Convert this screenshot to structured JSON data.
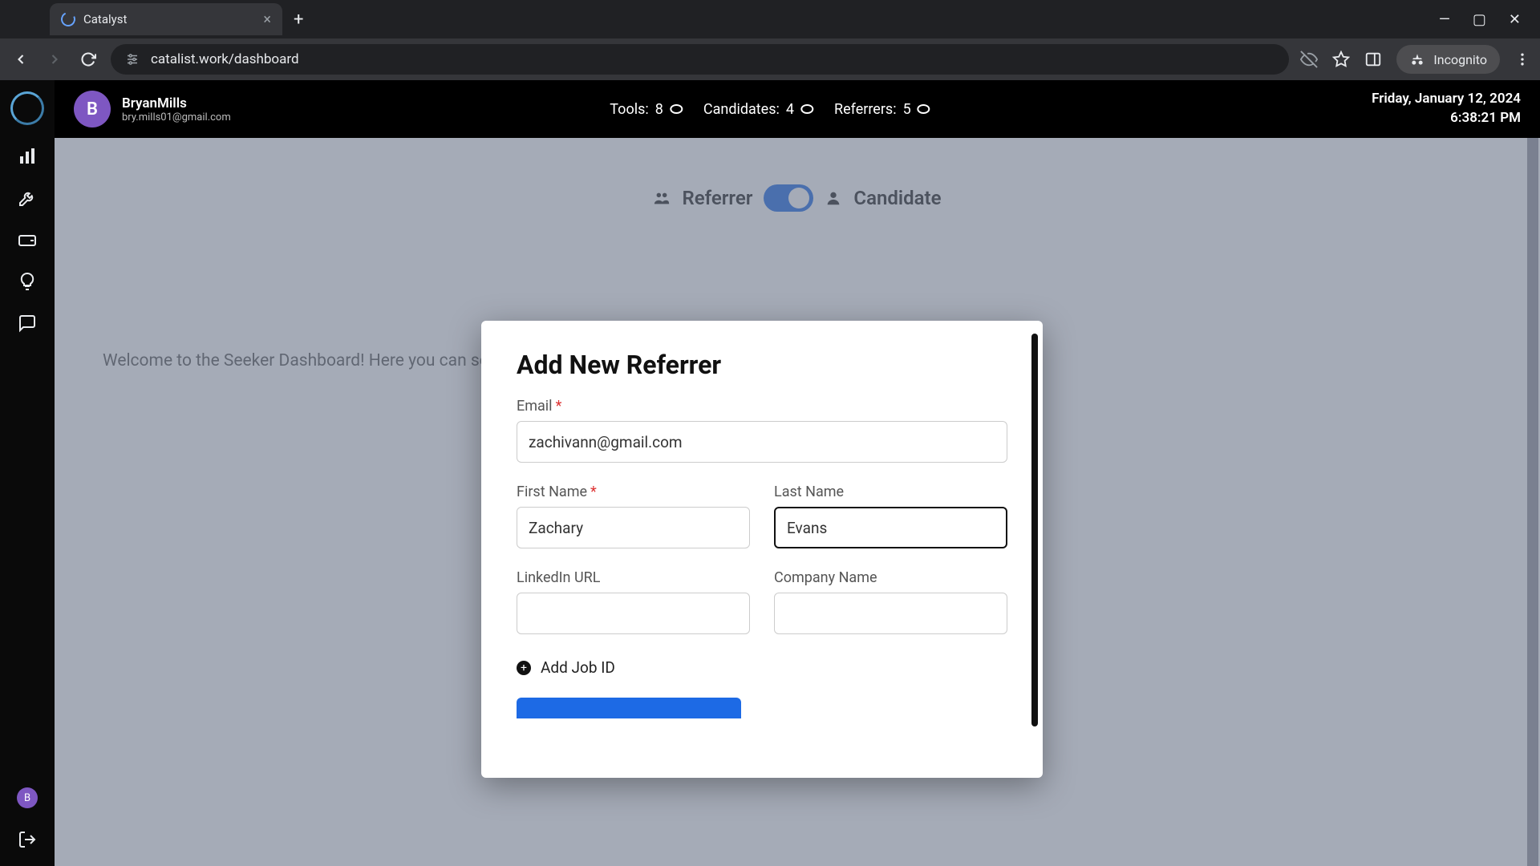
{
  "browser": {
    "tab_title": "Catalyst",
    "url": "catalist.work/dashboard",
    "incognito_label": "Incognito"
  },
  "header": {
    "user_name": "BryanMills",
    "user_email": "bry.mills01@gmail.com",
    "user_initial": "B",
    "stats": {
      "tools_label": "Tools:",
      "tools_value": "8",
      "candidates_label": "Candidates:",
      "candidates_value": "4",
      "referrers_label": "Referrers:",
      "referrers_value": "5"
    },
    "date": "Friday, January 12, 2024",
    "time": "6:38:21 PM"
  },
  "toggle": {
    "left": "Referrer",
    "right": "Candidate"
  },
  "welcome": "Welcome to the Seeker Dashboard! Here you can see the status of your referrals and jobs you have requested a referral for.",
  "modal": {
    "title": "Add New Referrer",
    "email_label": "Email",
    "email_value": "zachivann@gmail.com",
    "first_name_label": "First Name",
    "first_name_value": "Zachary",
    "last_name_label": "Last Name",
    "last_name_value": "Evans",
    "linkedin_label": "LinkedIn URL",
    "linkedin_value": "",
    "company_label": "Company Name",
    "company_value": "",
    "add_job_label": "Add Job ID"
  },
  "rail_avatar_initial": "B"
}
